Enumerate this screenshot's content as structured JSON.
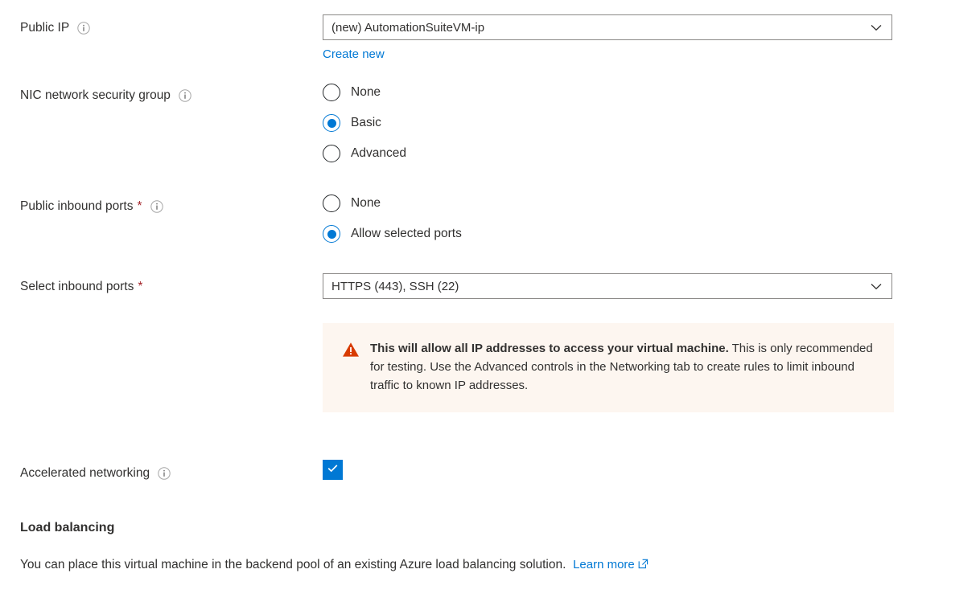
{
  "theme": {
    "accent": "#0078d4",
    "text": "#323130",
    "required_star": "#a4262c",
    "warning_bg": "#fdf6f0",
    "warning_icon": "#d83b01",
    "border": "#8a8886"
  },
  "fields": {
    "public_ip": {
      "label": "Public IP",
      "info_icon": "info-icon",
      "dropdown_value": "(new) AutomationSuiteVM-ip",
      "chevron_icon": "chevron-down-icon",
      "create_new_link": "Create new"
    },
    "nic_nsg": {
      "label": "NIC network security group",
      "info_icon": "info-icon",
      "options": [
        {
          "label": "None",
          "selected": false
        },
        {
          "label": "Basic",
          "selected": true
        },
        {
          "label": "Advanced",
          "selected": false
        }
      ]
    },
    "public_inbound_ports": {
      "label": "Public inbound ports",
      "required": "*",
      "info_icon": "info-icon",
      "options": [
        {
          "label": "None",
          "selected": false
        },
        {
          "label": "Allow selected ports",
          "selected": true
        }
      ]
    },
    "select_inbound_ports": {
      "label": "Select inbound ports",
      "required": "*",
      "dropdown_value": "HTTPS (443), SSH (22)",
      "chevron_icon": "chevron-down-icon"
    },
    "warning": {
      "icon": "warning-triangle-icon",
      "strong_text": "This will allow all IP addresses to access your virtual machine.",
      "body_text": " This is only recommended for testing.  Use the Advanced controls in the Networking tab to create rules to limit inbound traffic to known IP addresses."
    },
    "accelerated_networking": {
      "label": "Accelerated networking",
      "info_icon": "info-icon",
      "checked": true,
      "check_icon": "checkmark-icon"
    }
  },
  "load_balancing": {
    "heading": "Load balancing",
    "description": "You can place this virtual machine in the backend pool of an existing Azure load balancing solution.",
    "learn_more_label": "Learn more",
    "external_icon": "external-link-icon"
  }
}
